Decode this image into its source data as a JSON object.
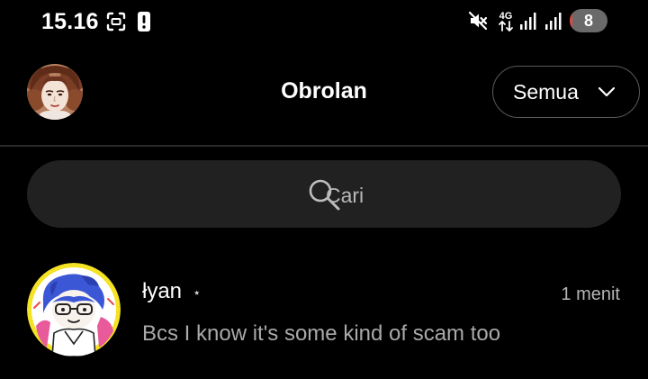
{
  "status_bar": {
    "time": "15.16",
    "network_label": "4G",
    "battery_level": "8",
    "battery_fraction": 0.08,
    "icons": [
      "screenshot-icon",
      "alert-icon",
      "mute-icon",
      "network-4g-icon",
      "signal-icon",
      "signal-icon",
      "battery-icon"
    ]
  },
  "header": {
    "title": "Obrolan",
    "filter_label": "Semua",
    "avatar_icon": "profile-avatar"
  },
  "search": {
    "placeholder": "Cari",
    "value": ""
  },
  "conversations": [
    {
      "name": "łyan",
      "star": "⋆",
      "time": "1 menit",
      "preview": "Bcs I know it's some kind of scam too"
    }
  ],
  "colors": {
    "background": "#000000",
    "surface": "#212121",
    "divider": "#2a2a2a",
    "battery_low": "#e2473d",
    "secondary_text": "#a9a9a9"
  }
}
